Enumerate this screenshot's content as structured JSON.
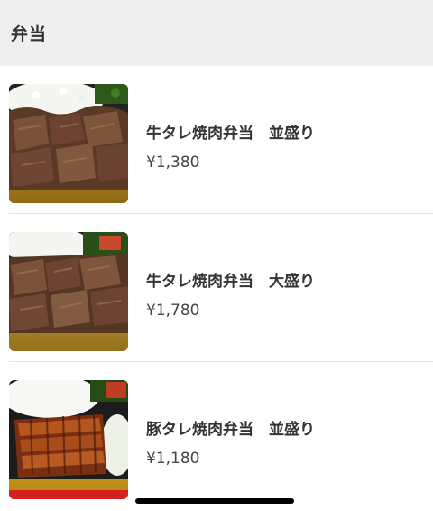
{
  "section": {
    "title": "弁当"
  },
  "items": [
    {
      "name": "牛タレ焼肉弁当　並盛り",
      "price": "¥1,380",
      "image": "beef-bento-photo"
    },
    {
      "name": "牛タレ焼肉弁当　大盛り",
      "price": "¥1,780",
      "image": "beef-bento-large-photo"
    },
    {
      "name": "豚タレ焼肉弁当　並盛り",
      "price": "¥1,180",
      "image": "pork-bento-photo"
    }
  ],
  "colors": {
    "header_bg": "#efefef",
    "text": "#333333",
    "divider": "#e2e2e2",
    "box_gold": "#c9a23a"
  }
}
